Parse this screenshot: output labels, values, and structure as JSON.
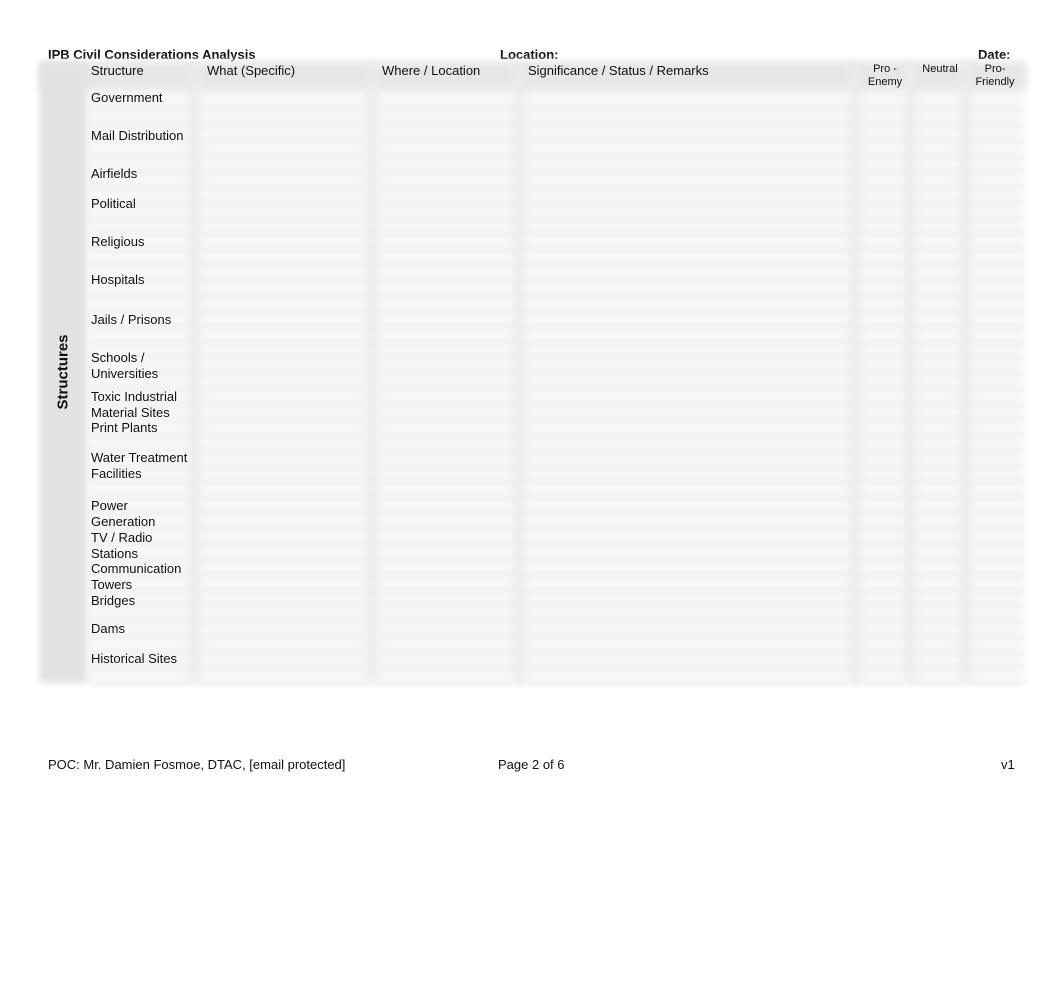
{
  "header": {
    "title": "IPB Civil Considerations Analysis",
    "location_label": "Location:",
    "date_label": "Date:"
  },
  "table": {
    "side_label": "Structures",
    "columns": {
      "structure": "Structure",
      "what": "What (Specific)",
      "where": "Where / Location",
      "significance": "Significance / Status / Remarks",
      "pro_enemy": "Pro -\nEnemy",
      "neutral": "Neutral",
      "pro_friendly": "Pro-\nFriendly"
    },
    "rows": [
      {
        "label": "Government"
      },
      {
        "label": "Mail Distribution"
      },
      {
        "label": "Airfields"
      },
      {
        "label": "Political"
      },
      {
        "label": "Religious"
      },
      {
        "label": "Hospitals"
      },
      {
        "label": "Jails / Prisons"
      },
      {
        "label": "Schools /\nUniversities"
      },
      {
        "label": "Toxic Industrial\nMaterial Sites"
      },
      {
        "label": "Print Plants"
      },
      {
        "label": "Water Treatment\nFacilities"
      },
      {
        "label": "Power\nGeneration"
      },
      {
        "label": "TV / Radio\nStations"
      },
      {
        "label": "Communication\nTowers"
      },
      {
        "label": "Bridges"
      },
      {
        "label": "Dams"
      },
      {
        "label": "Historical Sites"
      }
    ]
  },
  "footer": {
    "poc": "POC: Mr. Damien Fosmoe, DTAC, [email protected]",
    "page": "Page 2 of 6",
    "version": "v1"
  }
}
